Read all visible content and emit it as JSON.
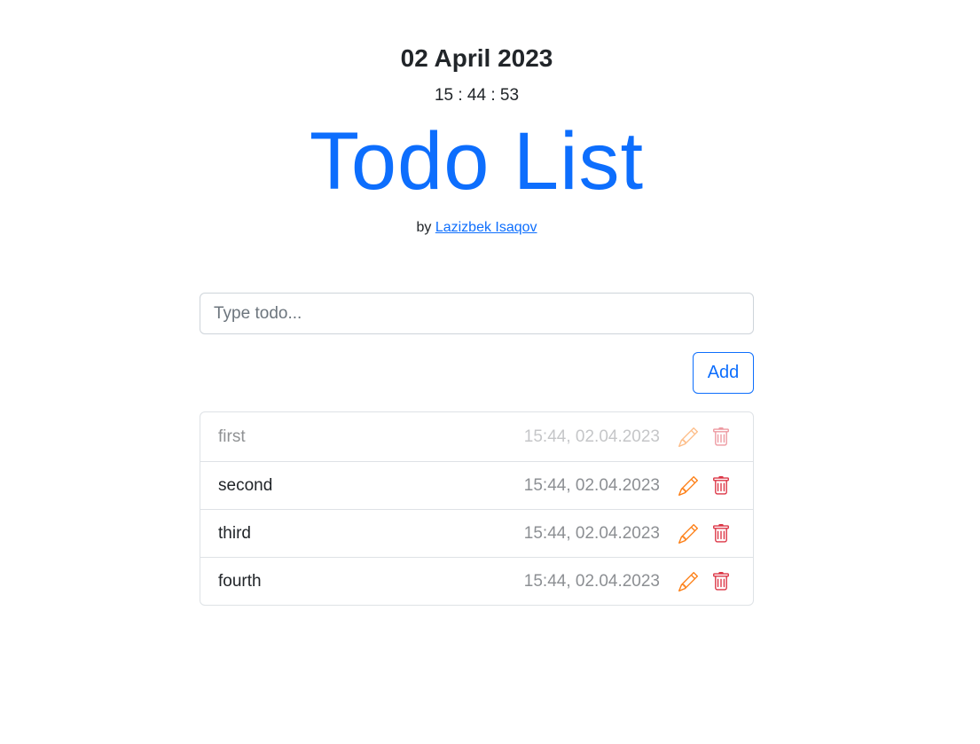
{
  "header": {
    "date": "02 April 2023",
    "clock": "15 : 44 : 53",
    "title": "Todo List",
    "by_prefix": "by",
    "author": "Lazizbek Isaqov"
  },
  "form": {
    "input_placeholder": "Type todo...",
    "input_value": "",
    "add_label": "Add"
  },
  "todos": [
    {
      "text": "first",
      "time": "15:44, 02.04.2023",
      "done": true
    },
    {
      "text": "second",
      "time": "15:44, 02.04.2023",
      "done": false
    },
    {
      "text": "third",
      "time": "15:44, 02.04.2023",
      "done": false
    },
    {
      "text": "fourth",
      "time": "15:44, 02.04.2023",
      "done": false
    }
  ],
  "colors": {
    "accent": "#0d6efd",
    "edit_icon": "#fd7e14",
    "delete_icon": "#dc3545"
  },
  "icons": {
    "edit": "pencil-icon",
    "delete": "trash-icon"
  }
}
